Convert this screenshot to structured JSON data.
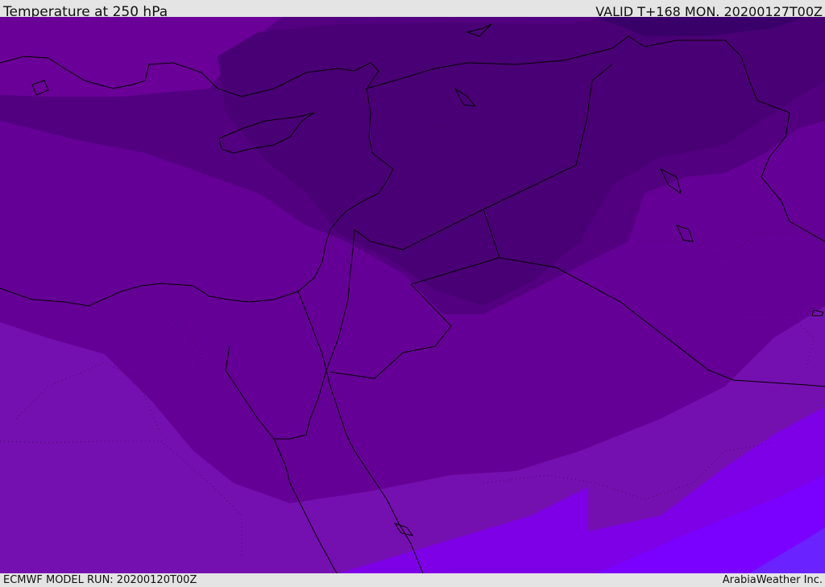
{
  "header": {
    "title": "Temperature at 250 hPa",
    "valid": "VALID T+168 MON. 20200127T00Z"
  },
  "footer": {
    "model_run": "ECMWF MODEL RUN: 20200120T00Z",
    "credit": "ArabiaWeather Inc."
  },
  "map": {
    "field": "temperature",
    "level": "250 hPa",
    "colors": {
      "band_darkest": "#3a006a",
      "band_dark": "#520080",
      "band_mid": "#650096",
      "band_light": "#7510b0",
      "band_lighter": "#7e00e6",
      "band_brightest": "#6a22ff",
      "coastline": "#000000"
    }
  }
}
